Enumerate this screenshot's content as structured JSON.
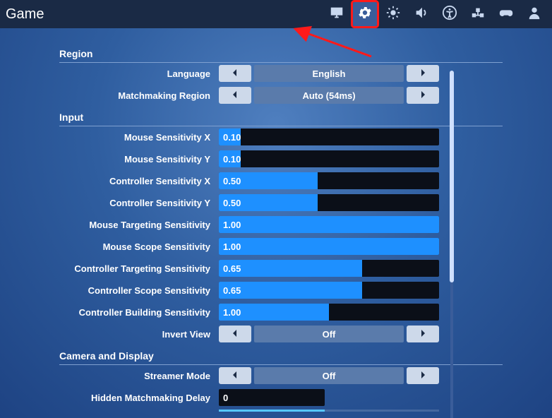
{
  "header": {
    "title": "Game"
  },
  "sections": {
    "region": "Region",
    "input": "Input",
    "camera": "Camera and Display"
  },
  "settings": {
    "language": {
      "label": "Language",
      "type": "selector",
      "value": "English"
    },
    "matchRegion": {
      "label": "Matchmaking Region",
      "type": "selector",
      "value": "Auto (54ms)"
    },
    "mouseSensX": {
      "label": "Mouse Sensitivity X",
      "type": "slider",
      "value": "0.10",
      "fill": 0.1
    },
    "mouseSensY": {
      "label": "Mouse Sensitivity Y",
      "type": "slider",
      "value": "0.10",
      "fill": 0.1
    },
    "ctrlSensX": {
      "label": "Controller Sensitivity X",
      "type": "slider",
      "value": "0.50",
      "fill": 0.45
    },
    "ctrlSensY": {
      "label": "Controller Sensitivity Y",
      "type": "slider",
      "value": "0.50",
      "fill": 0.45
    },
    "mouseTarget": {
      "label": "Mouse Targeting Sensitivity",
      "type": "slider",
      "value": "1.00",
      "fill": 1.0
    },
    "mouseScope": {
      "label": "Mouse Scope Sensitivity",
      "type": "slider",
      "value": "1.00",
      "fill": 1.0
    },
    "ctrlTarget": {
      "label": "Controller Targeting Sensitivity",
      "type": "slider",
      "value": "0.65",
      "fill": 0.65
    },
    "ctrlScope": {
      "label": "Controller Scope Sensitivity",
      "type": "slider",
      "value": "0.65",
      "fill": 0.65
    },
    "ctrlBuild": {
      "label": "Controller Building Sensitivity",
      "type": "slider",
      "value": "1.00",
      "fill": 0.5
    },
    "invertView": {
      "label": "Invert View",
      "type": "selector",
      "value": "Off"
    },
    "streamer": {
      "label": "Streamer Mode",
      "type": "selector",
      "value": "Off"
    },
    "hiddenDelay": {
      "label": "Hidden Matchmaking Delay",
      "type": "slider",
      "value": "0",
      "fill": 0.0
    }
  }
}
